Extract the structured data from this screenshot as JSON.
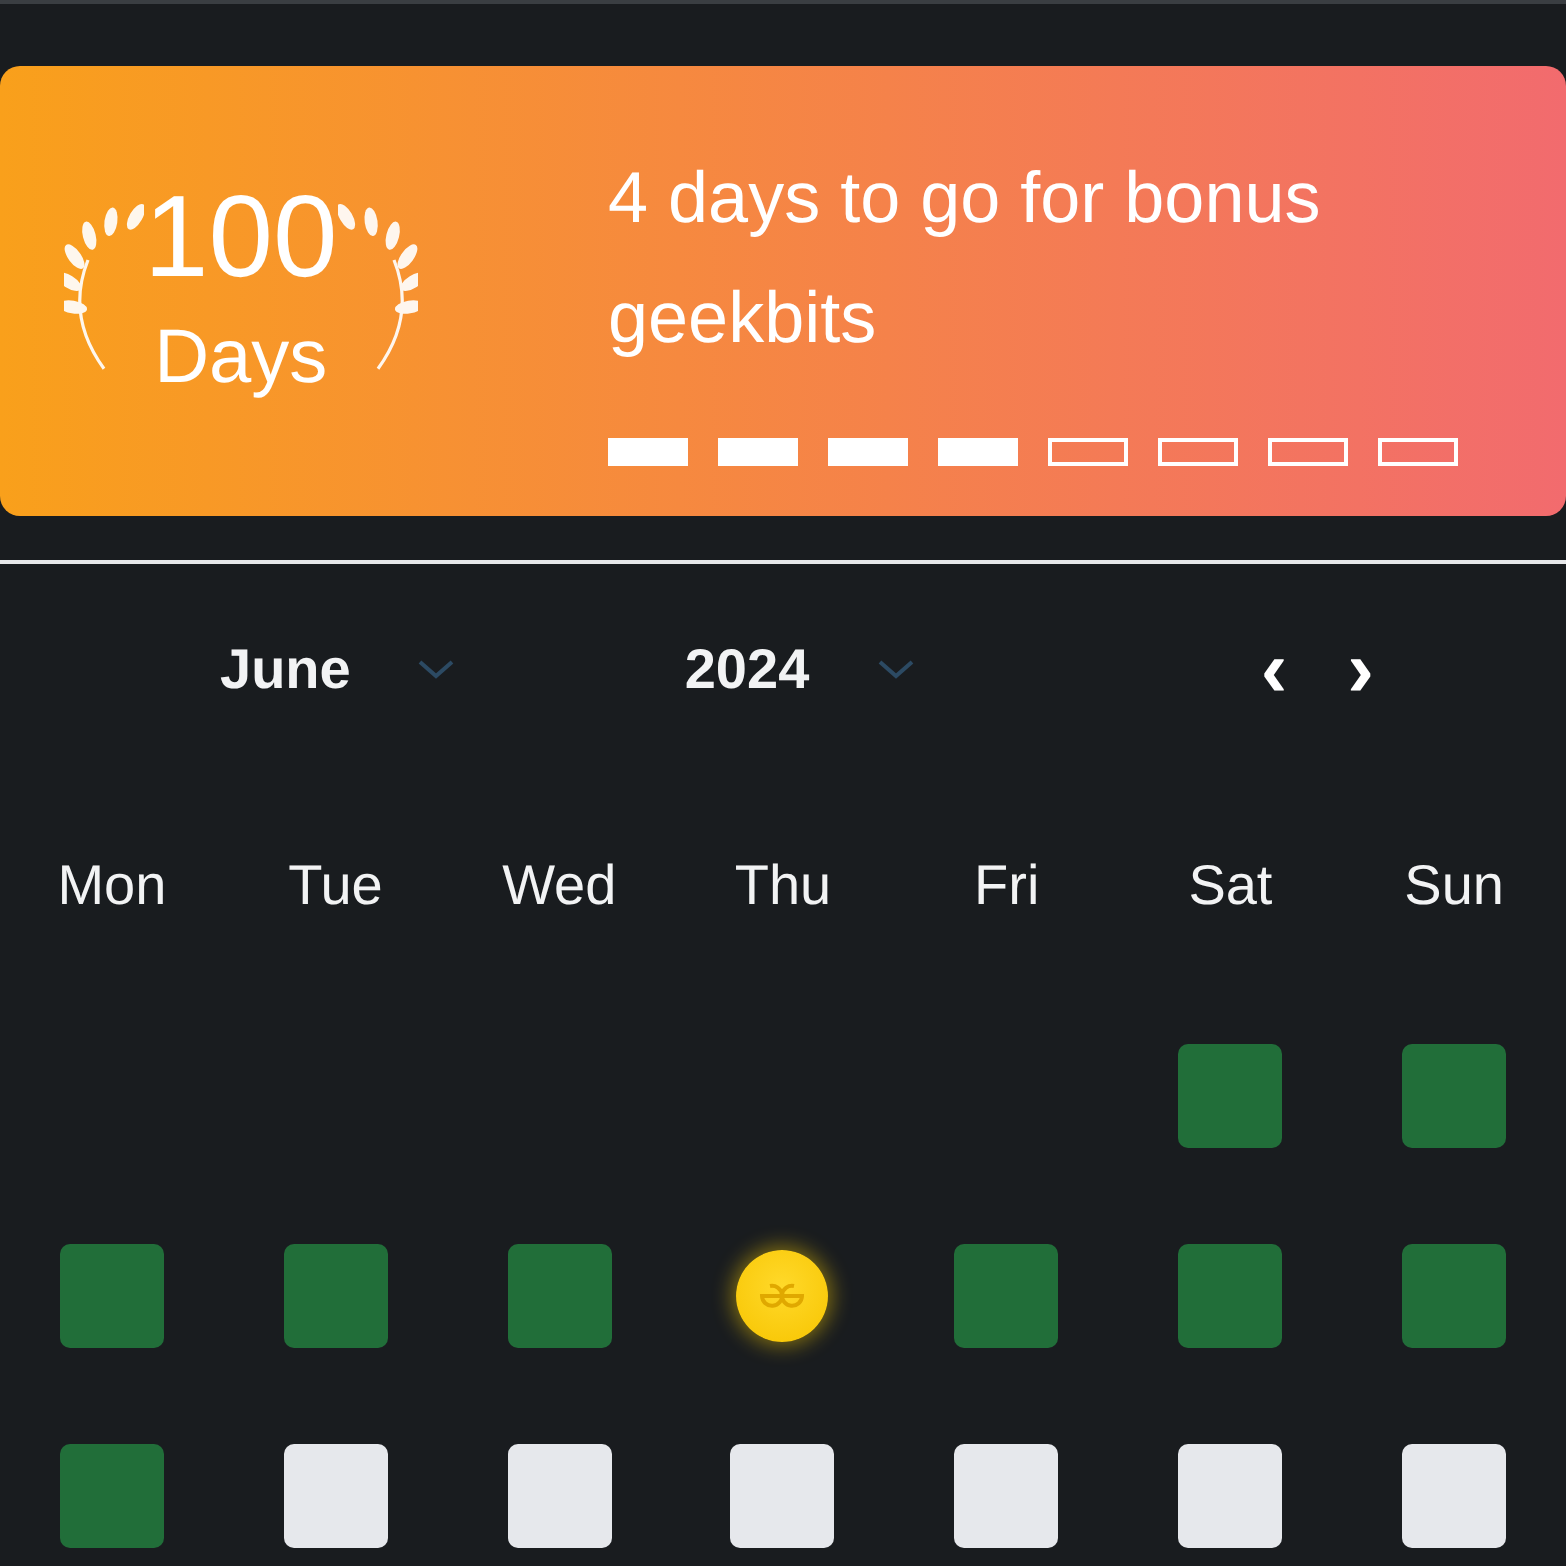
{
  "streak": {
    "count": "100",
    "unit": "Days",
    "message": "4 days to go for bonus geekbits",
    "segments": [
      {
        "filled": true
      },
      {
        "filled": true
      },
      {
        "filled": true
      },
      {
        "filled": true
      },
      {
        "filled": false
      },
      {
        "filled": false
      },
      {
        "filled": false
      },
      {
        "filled": false
      }
    ]
  },
  "calendar": {
    "month": "June",
    "year": "2024",
    "prev": "‹",
    "next": "›",
    "weekdays": [
      "Mon",
      "Tue",
      "Wed",
      "Thu",
      "Fri",
      "Sat",
      "Sun"
    ],
    "weeks": [
      [
        {
          "kind": "empty"
        },
        {
          "kind": "empty"
        },
        {
          "kind": "empty"
        },
        {
          "kind": "empty"
        },
        {
          "kind": "empty"
        },
        {
          "kind": "done"
        },
        {
          "kind": "done"
        }
      ],
      [
        {
          "kind": "done"
        },
        {
          "kind": "done"
        },
        {
          "kind": "done"
        },
        {
          "kind": "coin"
        },
        {
          "kind": "done"
        },
        {
          "kind": "done"
        },
        {
          "kind": "done"
        }
      ],
      [
        {
          "kind": "done"
        },
        {
          "kind": "pending"
        },
        {
          "kind": "pending"
        },
        {
          "kind": "pending"
        },
        {
          "kind": "pending"
        },
        {
          "kind": "pending"
        },
        {
          "kind": "pending"
        }
      ]
    ]
  }
}
